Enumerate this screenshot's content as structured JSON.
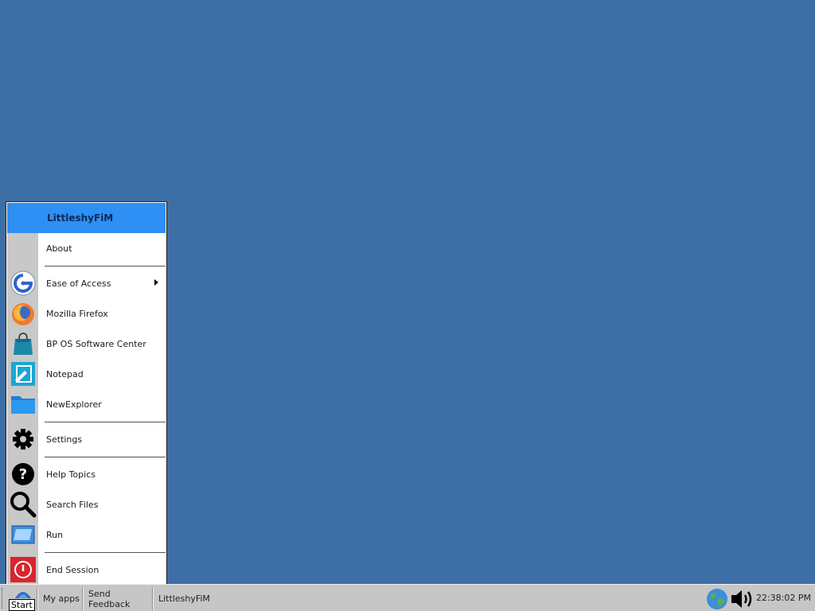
{
  "start_menu": {
    "header": "LittleshyFiM",
    "items": [
      {
        "label": "About",
        "icon": "blank"
      },
      {
        "label": "Ease of Access",
        "icon": "ease-of-access-icon",
        "submenu": true
      },
      {
        "label": "Mozilla Firefox",
        "icon": "firefox-icon"
      },
      {
        "label": "BP OS Software Center",
        "icon": "software-center-icon"
      },
      {
        "label": "Notepad",
        "icon": "notepad-icon"
      },
      {
        "label": "NewExplorer",
        "icon": "folder-icon"
      },
      {
        "label": "Settings",
        "icon": "gear-icon"
      },
      {
        "label": "Help Topics",
        "icon": "help-icon"
      },
      {
        "label": "Search Files",
        "icon": "search-icon"
      },
      {
        "label": "Run",
        "icon": "run-icon"
      },
      {
        "label": "End Session",
        "icon": "power-icon"
      }
    ]
  },
  "taskbar": {
    "start_label": "Start",
    "buttons": [
      "My apps",
      "Send Feedback",
      "LittleshyFiM"
    ],
    "clock": "22:38:02 PM"
  },
  "colors": {
    "desktop": "#3d6fa6",
    "menu_header": "#2e90f5",
    "taskbar": "#c6c6c6",
    "power_red": "#d8262e"
  }
}
